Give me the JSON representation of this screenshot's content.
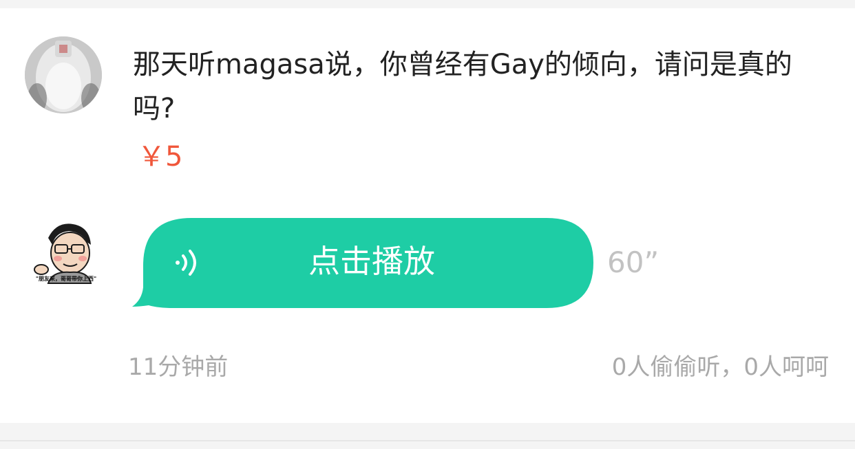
{
  "question": {
    "text": "那天听magasa说，你曾经有Gay的倾向，请问是真的吗?",
    "price": "￥5"
  },
  "answer": {
    "play_label": "点击播放",
    "duration": "60”",
    "avatar_caption": "\"朋友来，哥哥带你上西\"",
    "bubble_color": "#1ecda5",
    "play_icon": "sound-wave-icon"
  },
  "footer": {
    "time_ago": "11分钟前",
    "stats": "0人偷偷听，0人呵呵"
  },
  "colors": {
    "price": "#f0573b",
    "meta": "#a9a9a9",
    "question": "#222222"
  }
}
